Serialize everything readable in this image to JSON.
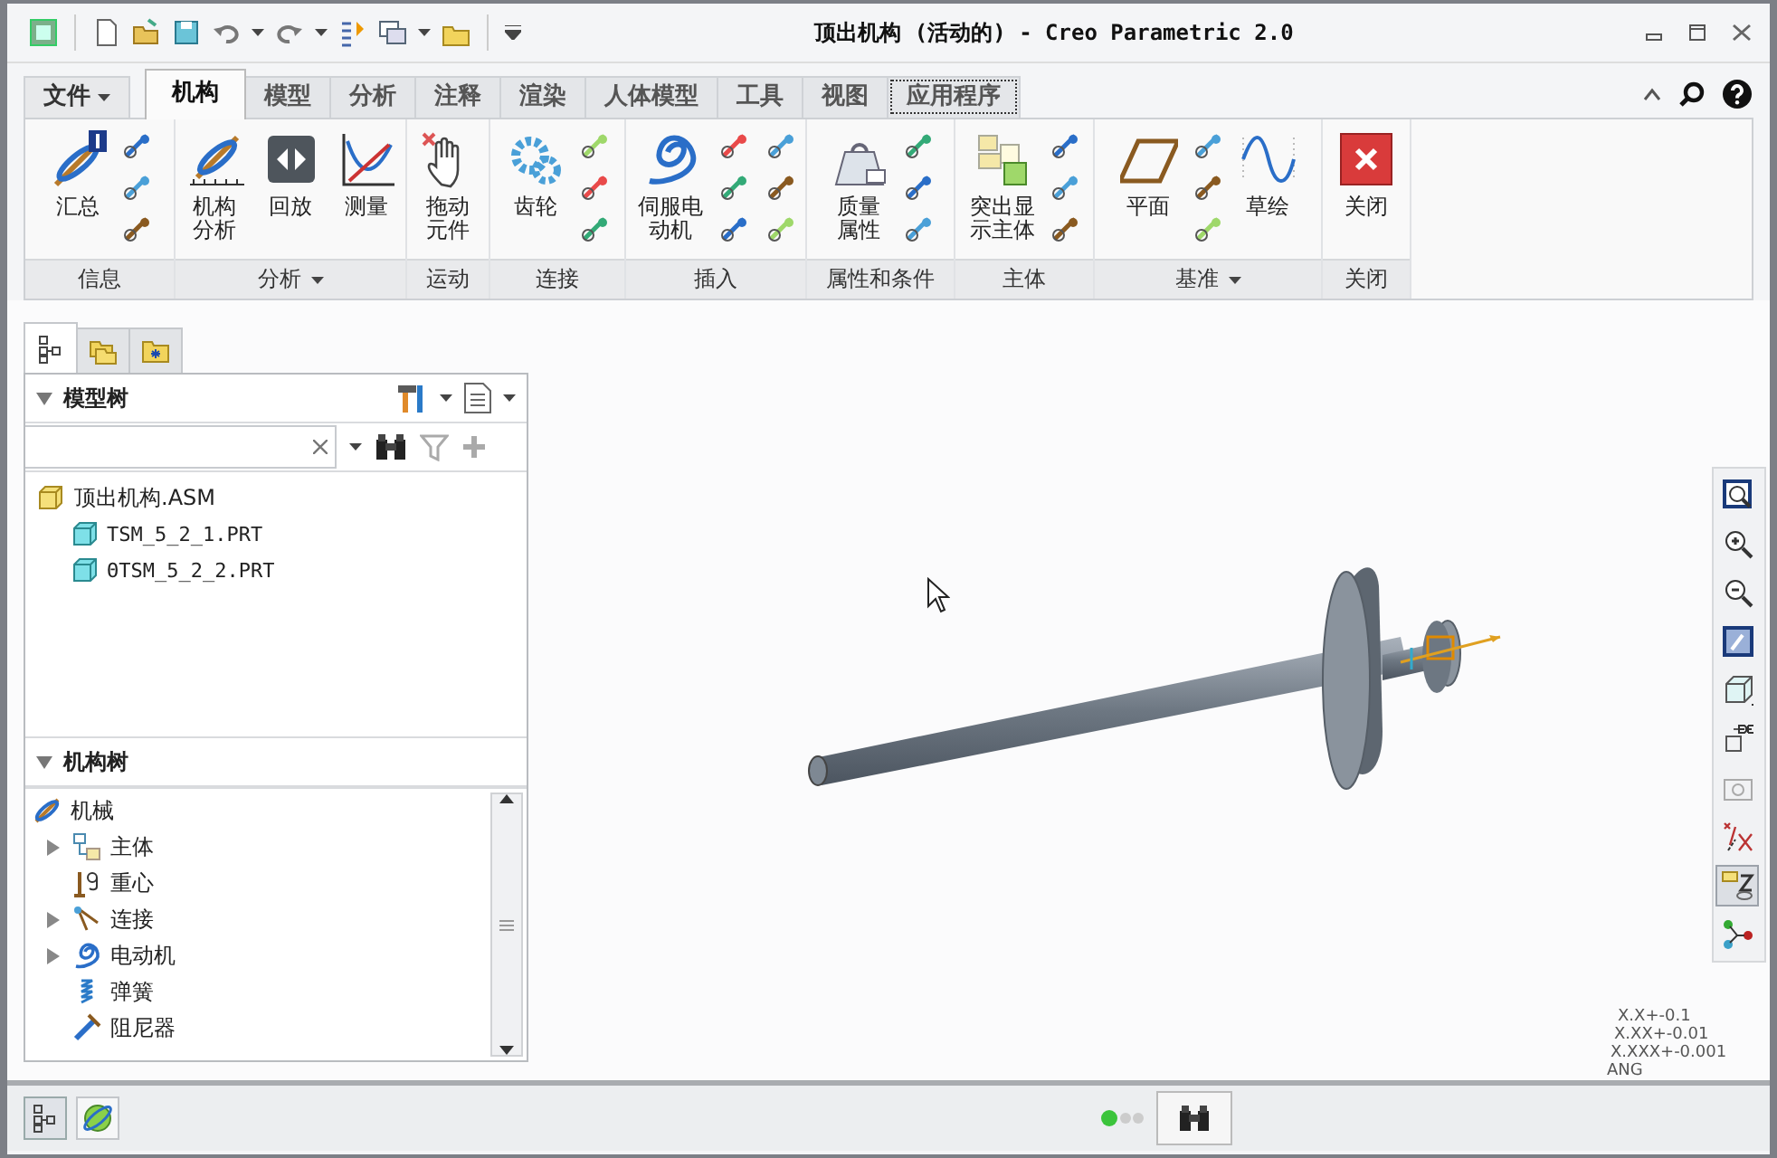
{
  "window": {
    "title": "顶出机构 (活动的) - Creo Parametric 2.0"
  },
  "ribbon_tabs": [
    {
      "label": "文件",
      "selected": false,
      "kind": "menu",
      "focused": false
    },
    {
      "label": "机构",
      "selected": true,
      "kind": "tab",
      "focused": false
    },
    {
      "label": "模型",
      "selected": false,
      "kind": "tab",
      "focused": false
    },
    {
      "label": "分析",
      "selected": false,
      "kind": "tab",
      "focused": false
    },
    {
      "label": "注释",
      "selected": false,
      "kind": "tab",
      "focused": false
    },
    {
      "label": "渲染",
      "selected": false,
      "kind": "tab",
      "focused": false
    },
    {
      "label": "人体模型",
      "selected": false,
      "kind": "tab",
      "focused": false
    },
    {
      "label": "工具",
      "selected": false,
      "kind": "tab",
      "focused": false
    },
    {
      "label": "视图",
      "selected": false,
      "kind": "tab",
      "focused": false
    },
    {
      "label": "应用程序",
      "selected": false,
      "kind": "tab",
      "focused": true
    }
  ],
  "ribbon_groups": [
    {
      "label": "信息",
      "dropdown": false,
      "buttons": [
        {
          "lines": [
            "汇总"
          ]
        }
      ]
    },
    {
      "label": "分析",
      "dropdown": true,
      "buttons": [
        {
          "lines": [
            "机构",
            "分析"
          ]
        },
        {
          "lines": [
            "回放"
          ]
        },
        {
          "lines": [
            "测量"
          ]
        }
      ]
    },
    {
      "label": "运动",
      "dropdown": false,
      "buttons": [
        {
          "lines": [
            "拖动",
            "元件"
          ]
        }
      ]
    },
    {
      "label": "连接",
      "dropdown": false,
      "buttons": [
        {
          "lines": [
            "齿轮"
          ]
        }
      ]
    },
    {
      "label": "插入",
      "dropdown": false,
      "buttons": [
        {
          "lines": [
            "伺服电",
            "动机"
          ]
        }
      ]
    },
    {
      "label": "属性和条件",
      "dropdown": false,
      "buttons": [
        {
          "lines": [
            "质量",
            "属性"
          ]
        }
      ]
    },
    {
      "label": "主体",
      "dropdown": false,
      "buttons": [
        {
          "lines": [
            "突出显",
            "示主体"
          ]
        }
      ]
    },
    {
      "label": "基准",
      "dropdown": true,
      "buttons": [
        {
          "lines": [
            "平面"
          ]
        },
        {
          "lines": [
            "草绘"
          ]
        }
      ]
    },
    {
      "label": "关闭",
      "dropdown": false,
      "buttons": [
        {
          "lines": [
            "关闭"
          ]
        }
      ]
    }
  ],
  "panel_tabs": [
    {
      "selected": true
    },
    {
      "selected": false
    },
    {
      "selected": false
    }
  ],
  "model_tree": {
    "title": "模型树",
    "items": [
      {
        "label": "顶出机构.ASM",
        "children": [
          {
            "label": "TSM_5_2_1.PRT"
          },
          {
            "label": "ΘTSM_5_2_2.PRT"
          }
        ]
      }
    ]
  },
  "mechanism_tree": {
    "title": "机构树",
    "items": [
      {
        "label": "机械",
        "children": [
          {
            "label": "主体",
            "expanded": false
          },
          {
            "label": "重心"
          },
          {
            "label": "连接",
            "expanded": false
          },
          {
            "label": "电动机",
            "expanded": false
          },
          {
            "label": "弹簧"
          },
          {
            "label": "阻尼器"
          }
        ]
      }
    ]
  },
  "view_tools": [
    {
      "pressed": false
    },
    {
      "pressed": false
    },
    {
      "pressed": false
    },
    {
      "pressed": false
    },
    {
      "pressed": false
    },
    {
      "pressed": false
    },
    {
      "pressed": false
    },
    {
      "pressed": false
    },
    {
      "pressed": true
    },
    {
      "pressed": false
    }
  ],
  "tolerances": [
    "X.X+-0.1",
    "X.XX+-0.01",
    "X.XXX+-0.001",
    "ANG"
  ]
}
